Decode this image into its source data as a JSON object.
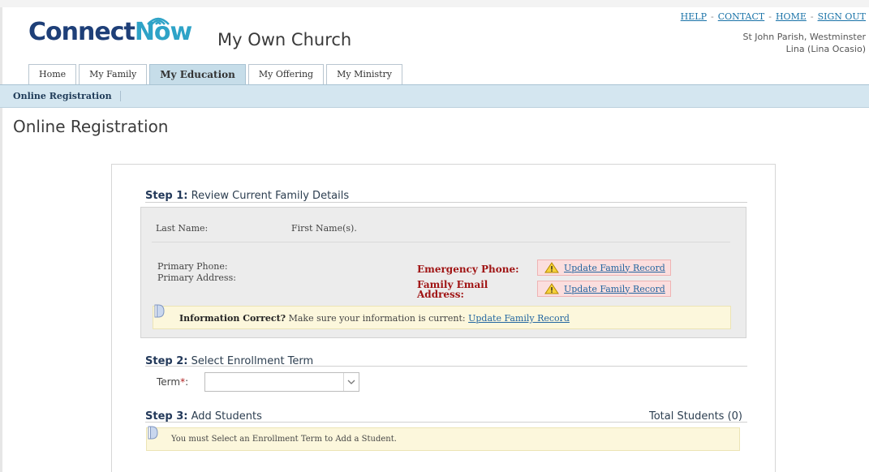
{
  "brand": {
    "logo_part1": "Connect",
    "logo_part2": "Now",
    "church_name": "My Own Church"
  },
  "toplinks": {
    "help": "HELP",
    "contact": "CONTACT",
    "home": "HOME",
    "signout": "SIGN OUT",
    "separator": "-"
  },
  "account": {
    "parish": "St John Parish, Westminster",
    "user": "Lina (Lina Ocasio)"
  },
  "tabs": [
    {
      "label": "Home",
      "active": false
    },
    {
      "label": "My Family",
      "active": false
    },
    {
      "label": "My Education",
      "active": true
    },
    {
      "label": "My Offering",
      "active": false
    },
    {
      "label": "My Ministry",
      "active": false
    }
  ],
  "subnav": {
    "item": "Online Registration"
  },
  "page": {
    "title": "Online Registration"
  },
  "step1": {
    "number": "Step 1:",
    "title": "Review Current Family Details",
    "last_name_label": "Last Name:",
    "first_name_label": "First Name(s).",
    "primary_phone_label": "Primary Phone:",
    "primary_address_label": "Primary Address:",
    "emergency_phone_label": "Emergency Phone:",
    "family_email_label_1": "Family Email",
    "family_email_label_2": "Address:",
    "update_link": "Update Family Record",
    "info_bold": "Information Correct?",
    "info_text": "Make sure your information is current:",
    "info_link": "Update Family Record"
  },
  "step2": {
    "number": "Step 2:",
    "title": "Select Enrollment Term",
    "term_label": "Term",
    "required_mark": "*",
    "term_colon": ":",
    "term_value": ""
  },
  "step3": {
    "number": "Step 3:",
    "title": "Add Students",
    "total_students": "Total Students (0)",
    "notice": "You must Select an Enrollment Term to Add a Student."
  },
  "colors": {
    "logo_dark": "#1e3f78",
    "logo_light": "#2ea3c7",
    "subnav_bg": "#d4e6f0",
    "active_tab_bg": "#c6dde9",
    "warning_red": "#a01515",
    "link_blue": "#2366a0",
    "info_bg": "#fcf7dc"
  }
}
